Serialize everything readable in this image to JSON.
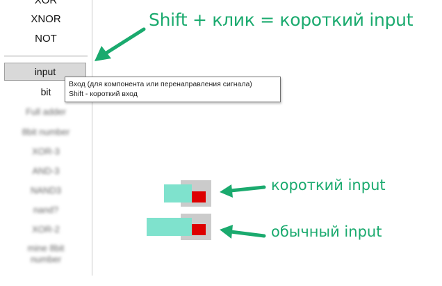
{
  "sidebar": {
    "items_top": [
      "XOR",
      "XNOR",
      "NOT"
    ],
    "input_label": "input",
    "bit_label": "bit",
    "blurred_items": [
      "Full adder",
      "8bit number",
      "XOR-3",
      "AND-3",
      "NAND3",
      "nand?",
      "XOR-2",
      "mine 8bit number"
    ]
  },
  "tooltip": {
    "line1": "Вход (для компонента или перенаправления сигнала)",
    "line2": "Shift - короткий вход"
  },
  "annotations": {
    "shift_click": "Shift + клик = короткий input",
    "short_input": "короткий input",
    "normal_input": "обычный input"
  },
  "colors": {
    "annotation": "#1aaa6e",
    "component_body": "#cbcbcb",
    "component_out": "#dd0000",
    "input_pad": "#7fe2cd"
  }
}
